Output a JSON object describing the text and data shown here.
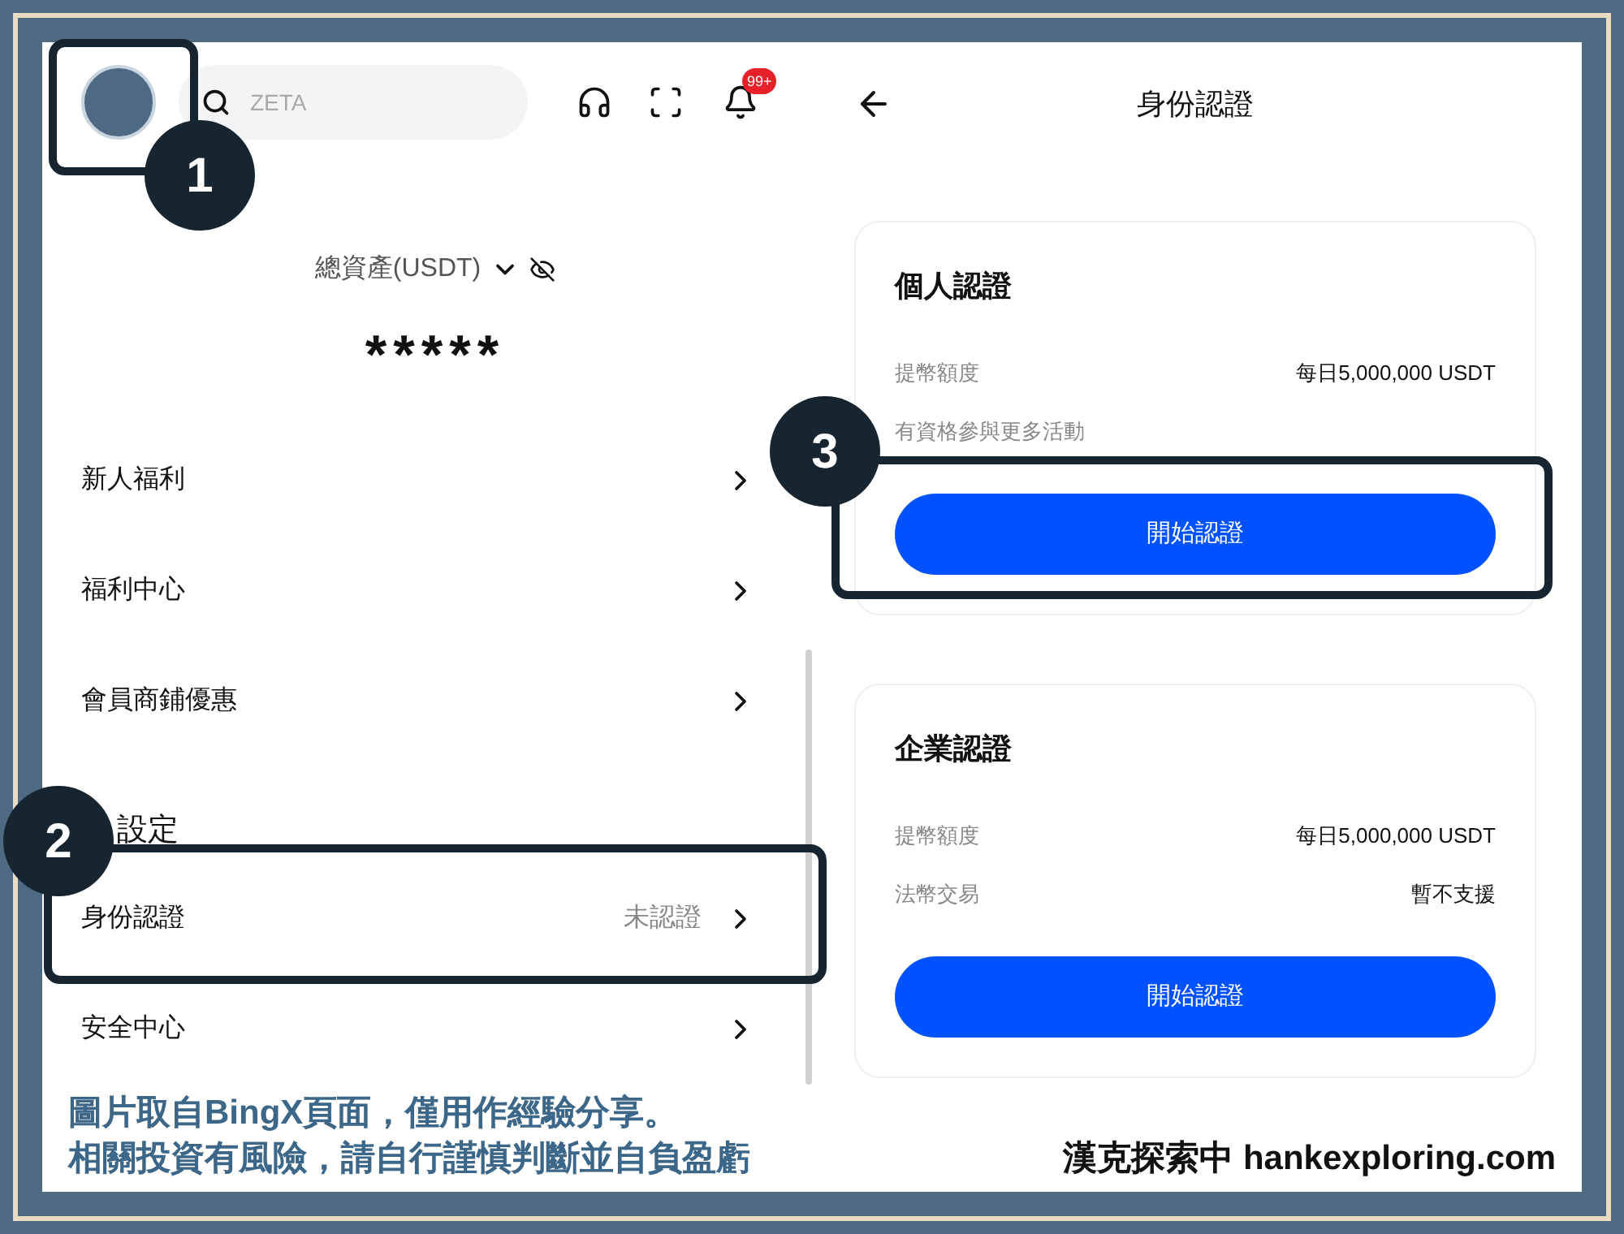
{
  "header": {
    "search": {
      "placeholder": "ZETA"
    },
    "notification_badge": "99+"
  },
  "assets": {
    "label": "總資產(USDT)",
    "value": "*****"
  },
  "menu": [
    {
      "label": "新人福利"
    },
    {
      "label": "福利中心"
    },
    {
      "label": "會員商鋪優惠"
    }
  ],
  "settings": {
    "title": "設定",
    "items": [
      {
        "label": "身份認證",
        "status": "未認證"
      },
      {
        "label": "安全中心"
      }
    ]
  },
  "verification": {
    "title": "身份認證",
    "cards": [
      {
        "title": "個人認證",
        "rows": [
          {
            "label": "提幣額度",
            "value": "每日5,000,000 USDT"
          },
          {
            "label": "有資格參與更多活動"
          }
        ],
        "button": "開始認證"
      },
      {
        "title": "企業認證",
        "rows": [
          {
            "label": "提幣額度",
            "value": "每日5,000,000 USDT"
          },
          {
            "label": "法幣交易",
            "value": "暫不支援"
          }
        ],
        "button": "開始認證"
      }
    ]
  },
  "annotations": [
    {
      "number": "1"
    },
    {
      "number": "2"
    },
    {
      "number": "3"
    }
  ],
  "caption": {
    "lines": [
      "圖片取自BingX頁面，僅用作經驗分享。",
      "相關投資有風險，請自行謹慎判斷並自負盈虧"
    ],
    "site": "漢克探索中 hankexploring.com"
  }
}
